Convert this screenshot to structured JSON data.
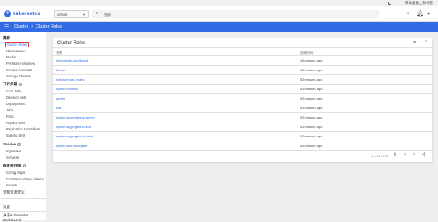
{
  "system_bar": {
    "text": "移动设备上的书签"
  },
  "topbar": {
    "brand": "kubernetes",
    "namespace": "default",
    "search_placeholder": "搜索",
    "icons": [
      "plus-icon",
      "bell-icon",
      "account-icon"
    ]
  },
  "breadcrumb": {
    "parent": "Cluster",
    "separator": ">",
    "current": "Cluster Roles"
  },
  "sidebar": {
    "cluster_heading": "集群",
    "cluster_items": [
      "Cluster Roles",
      "Namespaces",
      "Nodes",
      "Persistent Volumes",
      "Service Accounts",
      "Storage Classes"
    ],
    "workloads_heading": "工作负载",
    "workload_items": [
      "Cron Jobs",
      "Daemon Sets",
      "Deployments",
      "Jobs",
      "Pods",
      "Replica Sets",
      "Replication Controllers",
      "Stateful Sets"
    ],
    "service_heading": "Service",
    "service_items": [
      "Ingresses",
      "Services"
    ],
    "config_heading": "配置和存储",
    "config_items": [
      "Config Maps",
      "Persistent Volume Claims",
      "Secrets"
    ],
    "crd_heading": "定制资源定义",
    "settings": "设置",
    "about": "关于Kubernetes Dashboard"
  },
  "card": {
    "title": "Cluster Roles",
    "col_name": "名称",
    "col_created": "创建时间",
    "sort_indicator": "↑",
    "rows": [
      {
        "name": "kubernetes-dashboard",
        "age": "16 minutes ago"
      },
      {
        "name": "flannel",
        "age": "42 minutes ago"
      },
      {
        "name": "kubeadm:get-nodes",
        "age": "53 minutes ago"
      },
      {
        "name": "system:coredns",
        "age": "53 minutes ago"
      },
      {
        "name": "admin",
        "age": "53 minutes ago"
      },
      {
        "name": "edit",
        "age": "53 minutes ago"
      },
      {
        "name": "system:aggregate-to-admin",
        "age": "53 minutes ago"
      },
      {
        "name": "system:aggregate-to-edit",
        "age": "53 minutes ago"
      },
      {
        "name": "system:aggregate-to-view",
        "age": "53 minutes ago"
      },
      {
        "name": "system:auth-delegator",
        "age": "53 minutes ago"
      }
    ],
    "pagination": "1 – 10 of 62"
  }
}
